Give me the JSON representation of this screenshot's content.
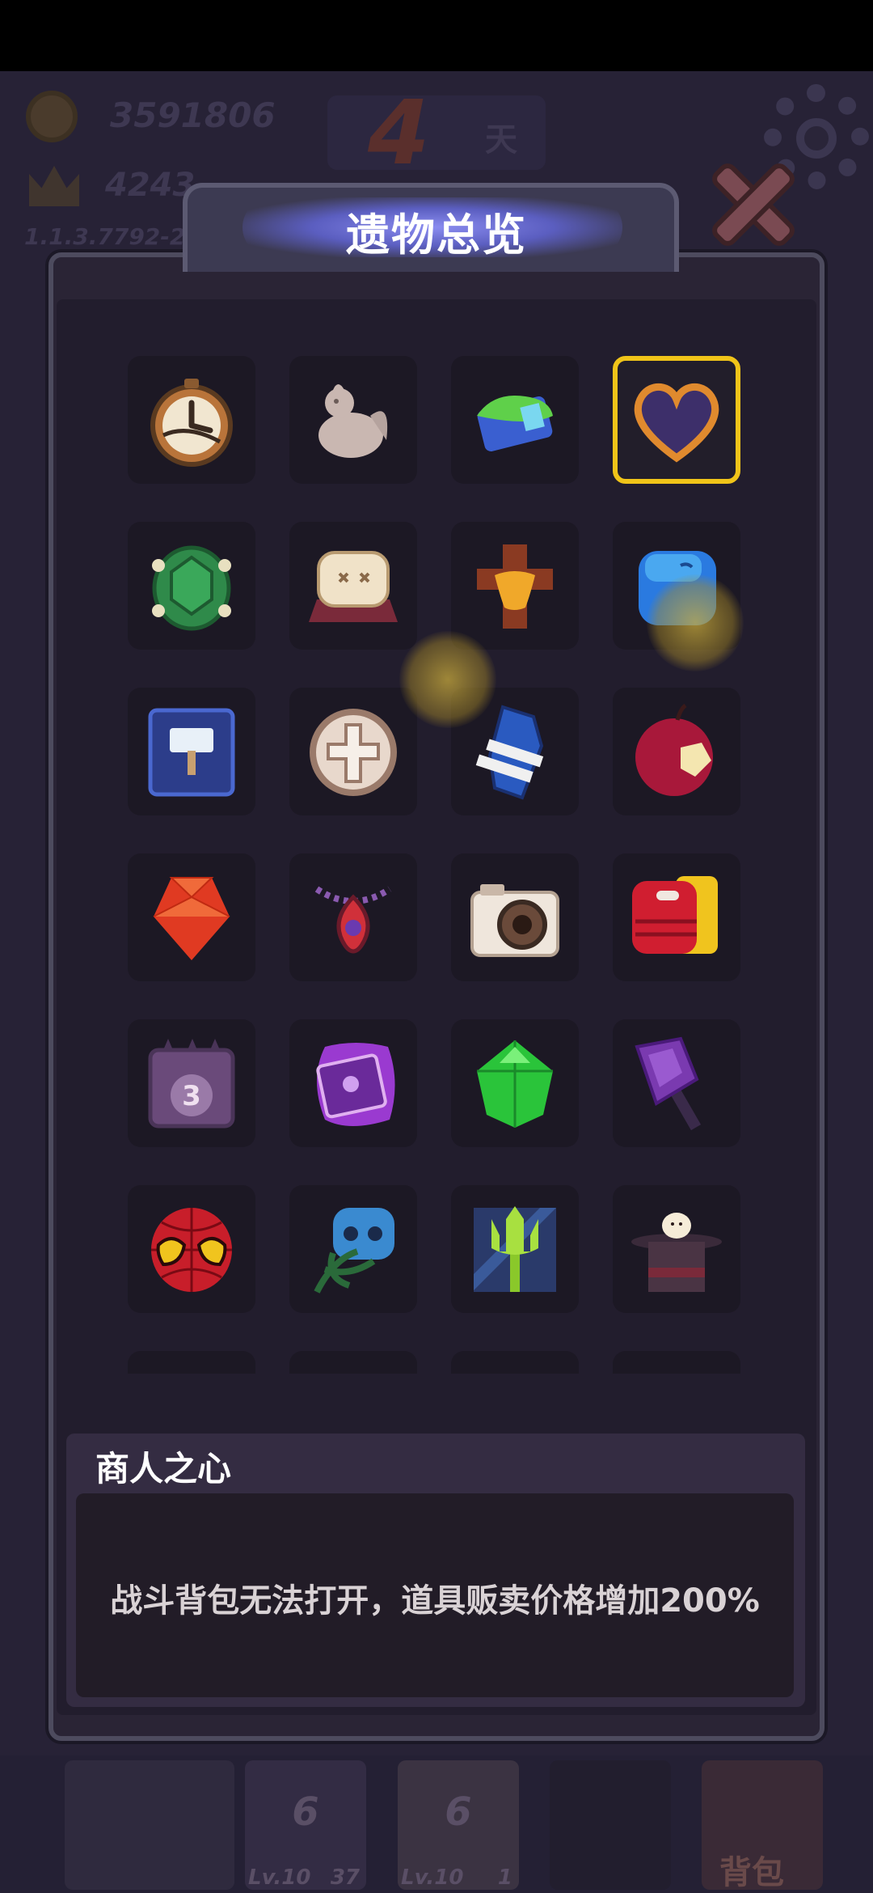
{
  "hud": {
    "coins": "3591806",
    "score": "4243",
    "version": "1.1.3.7792-2",
    "day_number": "4",
    "day_label": "天"
  },
  "dialog": {
    "title": "遗物总览",
    "selected_index": 3
  },
  "relics": [
    {
      "icon": "pocket-watch-icon"
    },
    {
      "icon": "stone-rooster-icon"
    },
    {
      "icon": "slime-bracer-icon"
    },
    {
      "icon": "merchant-heart-icon"
    },
    {
      "icon": "turtle-shell-icon"
    },
    {
      "icon": "pillow-icon"
    },
    {
      "icon": "golden-cross-icon"
    },
    {
      "icon": "blue-slime-cube-icon"
    },
    {
      "icon": "hammer-book-icon"
    },
    {
      "icon": "holy-cross-coin-icon"
    },
    {
      "icon": "blue-coffin-icon"
    },
    {
      "icon": "crimson-apple-icon"
    },
    {
      "icon": "red-crystal-icon"
    },
    {
      "icon": "flame-pendant-icon"
    },
    {
      "icon": "camera-icon"
    },
    {
      "icon": "red-mimic-icon"
    },
    {
      "icon": "skull-calendar-icon"
    },
    {
      "icon": "cursed-book-icon"
    },
    {
      "icon": "green-crystal-icon"
    },
    {
      "icon": "purple-axe-icon"
    },
    {
      "icon": "spider-mask-icon"
    },
    {
      "icon": "vine-skull-icon"
    },
    {
      "icon": "trident-icon"
    },
    {
      "icon": "magic-hat-icon"
    },
    {
      "icon": "partial-relic-icon"
    },
    {
      "icon": "partial-relic-icon"
    },
    {
      "icon": "partial-relic-icon"
    },
    {
      "icon": "partial-relic-icon"
    }
  ],
  "selected_relic": {
    "name": "商人之心",
    "description": "战斗背包无法打开，道具贩卖价格增加200%"
  },
  "bottom_bar": {
    "slots": [
      {
        "count_big": "6",
        "level": "Lv.10",
        "count": "37"
      },
      {
        "count_big": "6",
        "level": "Lv.10",
        "count": "1"
      }
    ],
    "bag_label": "背包"
  },
  "colors": {
    "selection": "#f0c419",
    "panel": "#2a2435",
    "title_glow": "#8a8cf0"
  }
}
